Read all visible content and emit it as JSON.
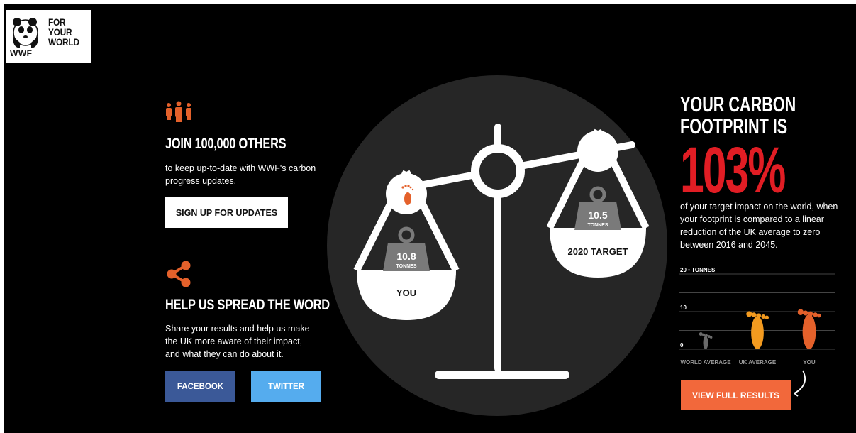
{
  "logo": {
    "brand": "WWF",
    "tagline_lines": [
      "FOR",
      "YOUR",
      "WORLD"
    ]
  },
  "join": {
    "heading": "JOIN 100,000 OTHERS",
    "text": "to keep up-to-date with WWF's carbon progress updates.",
    "button": "SIGN UP FOR UPDATES"
  },
  "share": {
    "heading": "HELP US SPREAD THE WORD",
    "text": "Share your results and help us make the UK more aware of their impact, and what they can do about it.",
    "facebook": "FACEBOOK",
    "twitter": "TWITTER"
  },
  "scale": {
    "you_label": "YOU",
    "you_value": "10.8",
    "you_unit": "TONNES",
    "target_label": "2020 TARGET",
    "target_value": "10.5",
    "target_unit": "TONNES"
  },
  "result": {
    "title_line1": "YOUR CARBON",
    "title_line2": "FOOTPRINT IS",
    "percent": "103%",
    "description": "of your target impact on the world, when your footprint is compared to a linear reduction of the UK average to zero between 2016 and 2045.",
    "button": "VIEW FULL RESULTS"
  },
  "chart_data": {
    "type": "bar",
    "categories": [
      "WORLD AVERAGE",
      "UK AVERAGE",
      "YOU"
    ],
    "values": [
      5,
      10.3,
      10.8
    ],
    "ytick_labels": [
      "20 • TONNES",
      "10",
      "0"
    ],
    "yticks": [
      20,
      10,
      0
    ],
    "ylim": [
      0,
      20
    ],
    "colors": [
      "#6b6b6b",
      "#f29a1f",
      "#e4612b"
    ],
    "icon": "footprint-icon"
  }
}
